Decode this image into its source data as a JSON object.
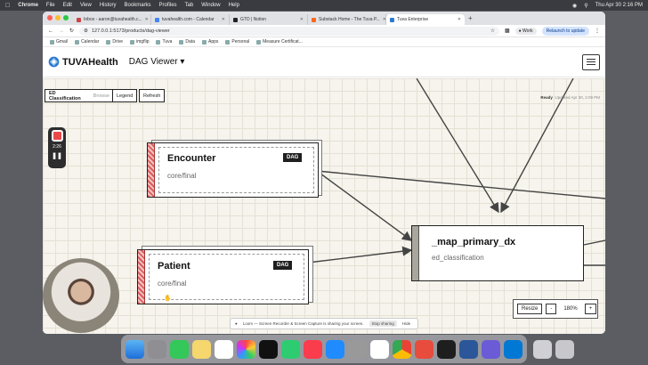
{
  "menubar": {
    "app": "Chrome",
    "items": [
      "File",
      "Edit",
      "View",
      "History",
      "Bookmarks",
      "Profiles",
      "Tab",
      "Window",
      "Help"
    ],
    "clock": "Thu Apr 30  2:16 PM"
  },
  "browser": {
    "tabs": [
      {
        "label": "Inbox - aaron@tuvahealth.c...",
        "active": false
      },
      {
        "label": "tuvahealth.com - Calendar",
        "active": false
      },
      {
        "label": "GTD | Notion",
        "active": false
      },
      {
        "label": "Substack Home - The Tuva P...",
        "active": false
      },
      {
        "label": "Tuva Enterprise",
        "active": true
      }
    ],
    "url": "127.0.0.1:5173/products/dag-viewer",
    "profile_label": "Work",
    "relaunch_label": "Relaunch to update",
    "bookmarks": [
      "Gmail",
      "Calendar",
      "Drive",
      "imgflip",
      "Tuva",
      "Data",
      "Apps",
      "Personal",
      "Measure Certificat..."
    ]
  },
  "app": {
    "logo_text": "TUVAHealth",
    "viewer_label": "DAG Viewer ▾"
  },
  "controls": {
    "selector_label": "ED Classification",
    "browse_label": "Browse",
    "legend_label": "Legend",
    "refresh_label": "Refresh",
    "status_ready": "Ready",
    "status_updated": "Updated Apr 30, 2:09 PM"
  },
  "nodes": {
    "encounter": {
      "name": "Encounter",
      "sub": "core/final",
      "tag": "DAG"
    },
    "patient": {
      "name": "Patient",
      "sub": "core/final",
      "tag": "DAG"
    },
    "map_primary_dx": {
      "name": "_map_primary_dx",
      "sub": "ed_classification"
    }
  },
  "zoom": {
    "resize_label": "Resize",
    "minus_label": "-",
    "value": "180%",
    "plus_label": "+"
  },
  "recorder": {
    "time": "2:26"
  },
  "sharebar": {
    "message": "Loom — Screen Recorder & Screen Capture is sharing your screen.",
    "stop_label": "Stop sharing",
    "hide_label": "Hide"
  },
  "colors": {
    "accent_red": "#d95f5f",
    "canvas_bg": "#f6f4ec",
    "node_border": "#222222"
  }
}
